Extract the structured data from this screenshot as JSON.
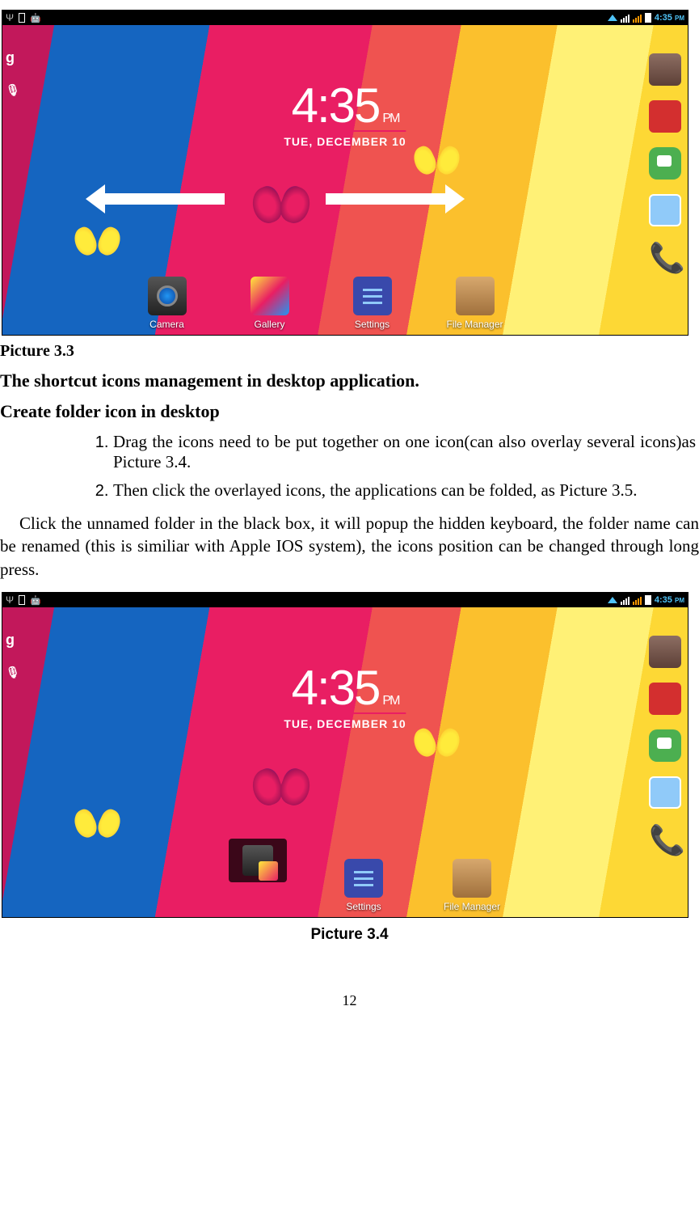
{
  "statusbar": {
    "time": "4:35",
    "period": "PM"
  },
  "clock": {
    "hour": "4",
    "minute": "35",
    "period": "PM",
    "date": "TUE, DECEMBER 10"
  },
  "dock": {
    "camera": "Camera",
    "gallery": "Gallery",
    "settings": "Settings",
    "filemanager": "File Manager"
  },
  "text": {
    "caption33": "Picture 3.3",
    "heading1": "The shortcut icons management in desktop application.",
    "heading2": "Create folder icon in desktop",
    "step1": "Drag the icons need to be put together on one icon(can also overlay several icons)as Picture 3.4.",
    "step2": "Then click the overlayed icons, the applications can be folded, as Picture 3.5.",
    "para1": "Click the unnamed folder in the black box, it will popup the hidden keyboard, the folder name can be renamed (this is similiar with Apple IOS system), the icons position can be changed through long press.",
    "caption34": "Picture 3.4",
    "pagenum": "12"
  },
  "sidebar_left": {
    "google": "g",
    "mic": "🎤"
  }
}
